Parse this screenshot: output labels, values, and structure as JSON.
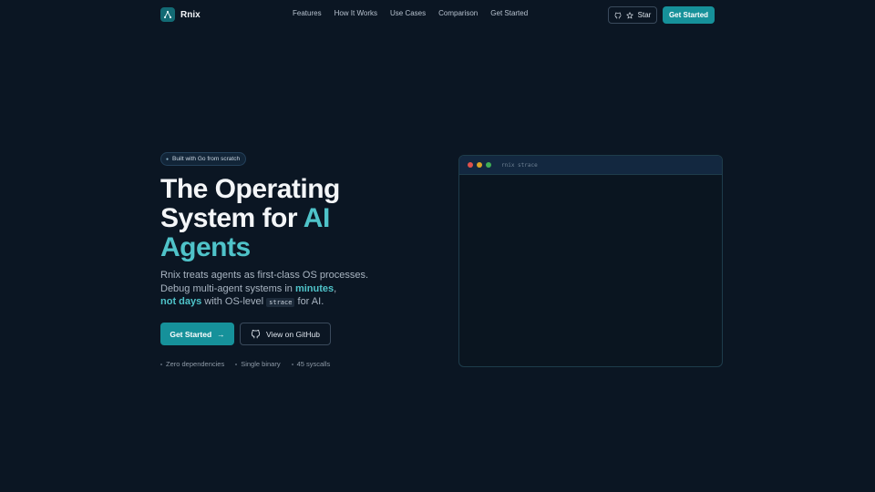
{
  "nav": {
    "logo_text": "Rnix",
    "links": [
      "Features",
      "How It Works",
      "Use Cases",
      "Comparison",
      "Get Started"
    ],
    "star_label": "Star",
    "cta_label": "Get Started"
  },
  "hero": {
    "badge": "Built with Go from scratch",
    "headline_line1": "The Operating",
    "headline_line2_plain": "System for ",
    "headline_line2_accent": "AI",
    "headline_line3_accent": "Agents",
    "sub_line1": "Rnix treats agents as first-class OS processes.",
    "sub_line2_plain": "Debug multi-agent systems in ",
    "sub_line2_highlight": "minutes",
    "sub_line2_end": ",",
    "sub_line3_highlight": "not days",
    "sub_line3_plain": " with OS-level ",
    "sub_line3_code": "strace",
    "sub_line3_end": " for AI.",
    "primary_cta": "Get Started",
    "secondary_cta": "View on GitHub",
    "features": [
      "Zero dependencies",
      "Single binary",
      "45 syscalls"
    ]
  },
  "terminal": {
    "title": "rnix strace",
    "lights": [
      "#e0514b",
      "#d9a326",
      "#3fae55"
    ]
  },
  "colors": {
    "background": "#0b1623",
    "accent": "#4fc3c9",
    "button": "#16919a"
  }
}
